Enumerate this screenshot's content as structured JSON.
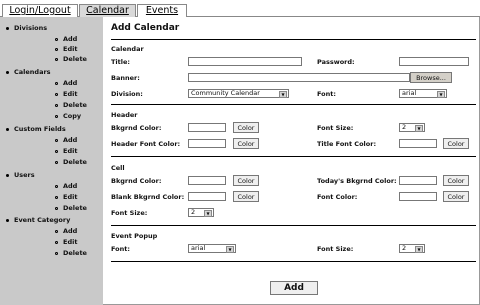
{
  "tabs": [
    "Login/Logout",
    "Calendar",
    "Events"
  ],
  "sidebar": {
    "sections": [
      {
        "label": "Divisions",
        "items": [
          "Add",
          "Edit",
          "Delete"
        ]
      },
      {
        "label": "Calendars",
        "items": [
          "Add",
          "Edit",
          "Delete",
          "Copy"
        ]
      },
      {
        "label": "Custom Fields",
        "items": [
          "Add",
          "Edit",
          "Delete"
        ]
      },
      {
        "label": "Users",
        "items": [
          "Add",
          "Edit",
          "Delete"
        ]
      },
      {
        "label": "Event Category",
        "items": [
          "Add",
          "Edit",
          "Delete"
        ]
      }
    ]
  },
  "page_title": "Add Calendar",
  "form": {
    "calendar": {
      "heading": "Calendar",
      "title_label": "Title:",
      "password_label": "Password:",
      "banner_label": "Banner:",
      "browse_label": "Browse...",
      "division_label": "Division:",
      "division_value": "Community Calendar",
      "font_label": "Font:",
      "font_value": "arial"
    },
    "header": {
      "heading": "Header",
      "bkgrnd_label": "Bkgrnd Color:",
      "font_size_label": "Font Size:",
      "font_size_value": "2",
      "header_font_label": "Header Font Color:",
      "title_font_label": "Title Font Color:"
    },
    "cell": {
      "heading": "Cell",
      "bkgrnd_label": "Bkgrnd Color:",
      "today_label": "Today's Bkgrnd Color:",
      "blank_label": "Blank Bkgrnd Color:",
      "font_color_label": "Font Color:",
      "font_size_label": "Font Size:",
      "font_size_value": "2"
    },
    "popup": {
      "heading": "Event Popup",
      "font_label": "Font:",
      "font_value": "arial",
      "font_size_label": "Font Size:",
      "font_size_value": "2"
    },
    "color_button": "Color",
    "add_button": "Add"
  }
}
